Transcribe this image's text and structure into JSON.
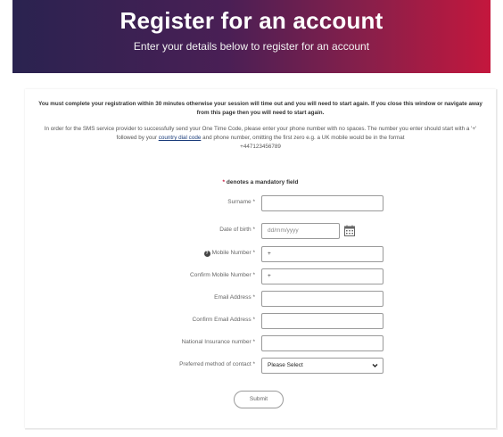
{
  "header": {
    "title": "Register for an account",
    "subtitle": "Enter your details below to register for an account"
  },
  "notice": {
    "timeout": "You must complete your registration within 30 minutes otherwise your session will time out and you will need to start again. If you close this window or navigate away from this page then you will need to start again.",
    "sms_before_link": "In order for the SMS service provider to successfully send your One Time Code, please enter your phone number with no spaces. The number you enter should start with a '+' followed by your ",
    "sms_link": "country dial code",
    "sms_after_link": " and phone number, omitting the first zero e.g. a UK mobile would be in the format",
    "example_number": "+447123456789"
  },
  "form": {
    "mandatory_star": "*",
    "mandatory_text": " denotes a mandatory field",
    "fields": [
      {
        "label": "Surname *",
        "value": ""
      },
      {
        "label": "Date of birth *",
        "placeholder": "dd/mm/yyyy"
      },
      {
        "label": "Mobile Number *",
        "value": "+"
      },
      {
        "label": "Confirm Mobile Number *",
        "value": "+"
      },
      {
        "label": "Email Address *",
        "value": ""
      },
      {
        "label": "Confirm Email Address *",
        "value": ""
      },
      {
        "label": "National Insurance number *",
        "value": ""
      },
      {
        "label": "Preferred method of contact *",
        "selected": "Please Select"
      }
    ],
    "submit_label": "Submit"
  },
  "icons": {
    "calendar": "calendar-icon",
    "info": "info-icon",
    "dropdown": "chevron-down-icon"
  },
  "colors": {
    "header_gradient_start": "#2a2350",
    "header_gradient_end": "#c4173d",
    "link": "#1a3c7a"
  }
}
